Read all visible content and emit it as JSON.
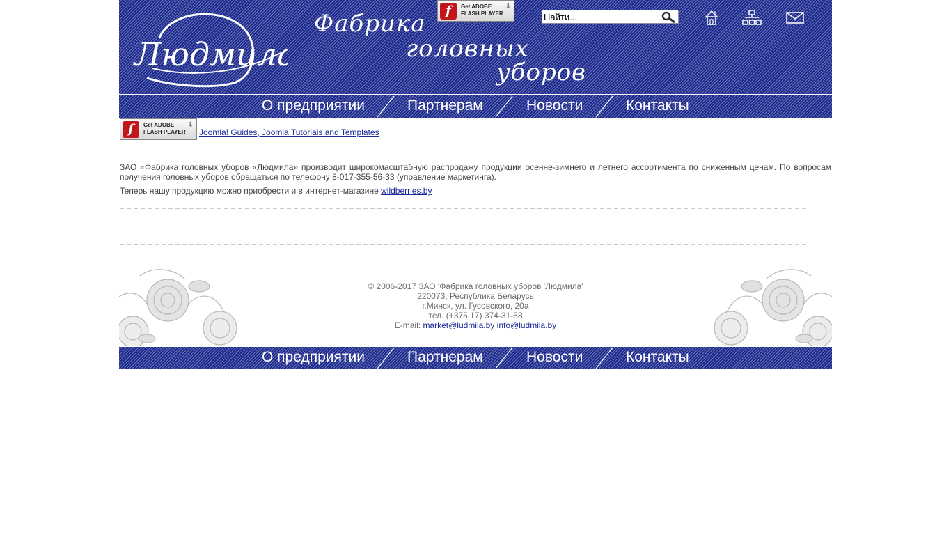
{
  "header": {
    "logo_text": "Людмила",
    "tagline": [
      "Фабрика",
      "головных",
      "уборов"
    ],
    "flash_badge": {
      "line1": "Get ADOBE",
      "line2": "FLASH PLAYER"
    },
    "search": {
      "placeholder": "Найти..."
    },
    "icons": [
      "home-icon",
      "sitemap-icon",
      "mail-icon"
    ]
  },
  "menu": {
    "items": [
      "О предприятии",
      "Партнерам",
      "Новости",
      "Контакты"
    ]
  },
  "content": {
    "flash_badge": {
      "line1": "Get ADOBE",
      "line2": "FLASH PLAYER"
    },
    "joomla_link": "Joomla! Guides, Joomla Tutorials and Templates",
    "paragraph1": "ЗАО «Фабрика головных уборов «Людмила» производит широкомасштабную распродажу продукции осенне-зимнего и летнего ассортимента по сниженным ценам. По вопросам получения головных уборов обращаться по телефону 8-017-355-56-33 (управление маркетинга).",
    "paragraph2_text": "Теперь нашу продукцию можно приобрести и в интернет-магазине ",
    "paragraph2_link": "wildberries.by"
  },
  "footer": {
    "copyright": "© 2006-2017 ЗАО 'Фабрика головных уборов 'Людмила'",
    "address1": "220073, Республика Беларусь",
    "address2": "г.Минск, ул. Гусовского, 20а",
    "phone": "тел. (+375 17) 374-31-58",
    "email_label": "E-mail:",
    "email1": "market@ludmila.by",
    "email2": "info@ludmila.by"
  },
  "colors": {
    "brand_blue": "#1c2a8e",
    "link": "#1a2a99"
  }
}
